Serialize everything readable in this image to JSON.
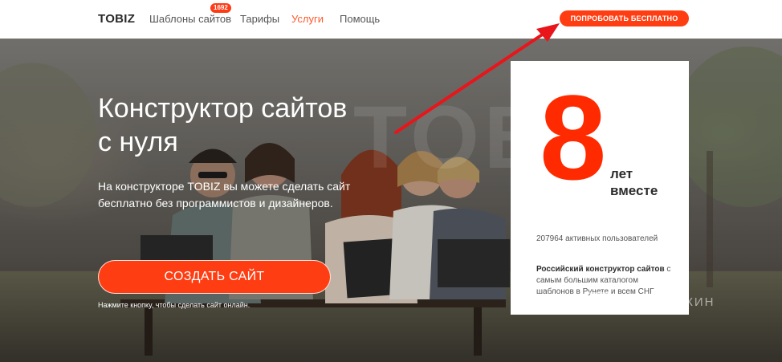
{
  "header": {
    "logo": "TOBIZ",
    "nav": [
      {
        "label": "Шаблоны сайтов",
        "badge": "1692"
      },
      {
        "label": "Тарифы"
      },
      {
        "label": "Услуги",
        "active": true
      },
      {
        "label": "Помощь"
      }
    ],
    "cta_label": "ПОПРОБОВАТЬ БЕСПЛАТНО"
  },
  "hero": {
    "title_line1": "Конструктор сайтов",
    "title_line2": "с нуля",
    "description": "На конструкторе TOBIZ вы можете сделать сайт бесплатно без программистов и дизайнеров.",
    "cta_label": "СОЗДАТЬ САЙТ",
    "cta_hint": "Нажмите кнопку, чтобы сделать сайт онлайн.",
    "background_text": "TOBIZ"
  },
  "card": {
    "big_number": "8",
    "years_line1": "лет",
    "years_line2": "вместе",
    "users_text": "207964 активных пользователей",
    "desc_bold": "Российский конструктор сайтов",
    "desc_rest": " с самым большим каталогом шаблонов в Рунете и всем СНГ"
  },
  "watermark": "ПАРТНЕРКИН",
  "colors": {
    "accent": "#ff3d12",
    "arrow": "#e8151b",
    "active_nav": "#ff5a2c"
  }
}
